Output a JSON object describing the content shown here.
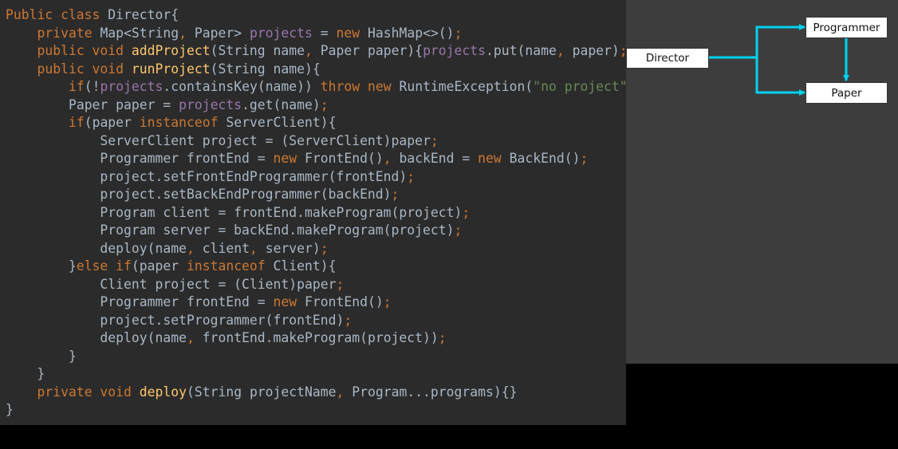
{
  "code": [
    [
      [
        "Public class ",
        "kw"
      ],
      [
        "Director{",
        ""
      ]
    ],
    [
      [
        "    ",
        ""
      ],
      [
        "private ",
        "kw"
      ],
      [
        "Map<String",
        ""
      ],
      [
        ", ",
        "kw"
      ],
      [
        "Paper> ",
        ""
      ],
      [
        "projects",
        "fld"
      ],
      [
        " = ",
        ""
      ],
      [
        "new ",
        "kw"
      ],
      [
        "HashMap<>()",
        ""
      ],
      [
        ";",
        "kw"
      ]
    ],
    [
      [
        "    ",
        ""
      ],
      [
        "public void ",
        "kw"
      ],
      [
        "addProject",
        "fn"
      ],
      [
        "(String name",
        ""
      ],
      [
        ", ",
        "kw"
      ],
      [
        "Paper paper){",
        ""
      ],
      [
        "projects",
        "fld"
      ],
      [
        ".put(name",
        ""
      ],
      [
        ", ",
        "kw"
      ],
      [
        "paper)",
        ""
      ],
      [
        ";",
        "kw"
      ],
      [
        "}",
        ""
      ]
    ],
    [
      [
        "    ",
        ""
      ],
      [
        "public void ",
        "kw"
      ],
      [
        "runProject",
        "fn"
      ],
      [
        "(String name){",
        ""
      ]
    ],
    [
      [
        "        ",
        ""
      ],
      [
        "if",
        "kw"
      ],
      [
        "(!",
        ""
      ],
      [
        "projects",
        "fld"
      ],
      [
        ".containsKey(name)) ",
        ""
      ],
      [
        "throw new ",
        "kw"
      ],
      [
        "RuntimeException(",
        ""
      ],
      [
        "\"no project\"",
        "str"
      ],
      [
        ")",
        ""
      ],
      [
        ";",
        "kw"
      ]
    ],
    [
      [
        "        ",
        ""
      ],
      [
        "Paper paper = ",
        ""
      ],
      [
        "projects",
        "fld"
      ],
      [
        ".get(name)",
        ""
      ],
      [
        ";",
        "kw"
      ]
    ],
    [
      [
        "        ",
        ""
      ],
      [
        "if",
        "kw"
      ],
      [
        "(paper ",
        ""
      ],
      [
        "instanceof ",
        "kw"
      ],
      [
        "ServerClient){",
        ""
      ]
    ],
    [
      [
        "            ",
        ""
      ],
      [
        "ServerClient project = (ServerClient)paper",
        ""
      ],
      [
        ";",
        "kw"
      ]
    ],
    [
      [
        "            ",
        ""
      ],
      [
        "Programmer frontEnd = ",
        ""
      ],
      [
        "new ",
        "kw"
      ],
      [
        "FrontEnd()",
        ""
      ],
      [
        ", ",
        "kw"
      ],
      [
        "backEnd = ",
        ""
      ],
      [
        "new ",
        "kw"
      ],
      [
        "BackEnd()",
        ""
      ],
      [
        ";",
        "kw"
      ]
    ],
    [
      [
        "            ",
        ""
      ],
      [
        "project.setFrontEndProgrammer(frontEnd)",
        ""
      ],
      [
        ";",
        "kw"
      ]
    ],
    [
      [
        "            ",
        ""
      ],
      [
        "project.setBackEndProgrammer(backEnd)",
        ""
      ],
      [
        ";",
        "kw"
      ]
    ],
    [
      [
        "            ",
        ""
      ],
      [
        "Program client = frontEnd.makeProgram(project)",
        ""
      ],
      [
        ";",
        "kw"
      ]
    ],
    [
      [
        "            ",
        ""
      ],
      [
        "Program server = backEnd.makeProgram(project)",
        ""
      ],
      [
        ";",
        "kw"
      ]
    ],
    [
      [
        "            ",
        ""
      ],
      [
        "deploy(name",
        ""
      ],
      [
        ", ",
        "kw"
      ],
      [
        "client",
        ""
      ],
      [
        ", ",
        "kw"
      ],
      [
        "server)",
        ""
      ],
      [
        ";",
        "kw"
      ]
    ],
    [
      [
        "        ",
        ""
      ],
      [
        "}",
        ""
      ],
      [
        "else if",
        "kw"
      ],
      [
        "(paper ",
        ""
      ],
      [
        "instanceof ",
        "kw"
      ],
      [
        "Client){",
        ""
      ]
    ],
    [
      [
        "            ",
        ""
      ],
      [
        "Client project = (Client)paper",
        ""
      ],
      [
        ";",
        "kw"
      ]
    ],
    [
      [
        "            ",
        ""
      ],
      [
        "Programmer frontEnd = ",
        ""
      ],
      [
        "new ",
        "kw"
      ],
      [
        "FrontEnd()",
        ""
      ],
      [
        ";",
        "kw"
      ]
    ],
    [
      [
        "            ",
        ""
      ],
      [
        "project.setProgrammer(frontEnd)",
        ""
      ],
      [
        ";",
        "kw"
      ]
    ],
    [
      [
        "            ",
        ""
      ],
      [
        "deploy(name",
        ""
      ],
      [
        ", ",
        "kw"
      ],
      [
        "frontEnd.makeProgram(project))",
        ""
      ],
      [
        ";",
        "kw"
      ]
    ],
    [
      [
        "        ",
        ""
      ],
      [
        "}",
        ""
      ]
    ],
    [
      [
        "    ",
        ""
      ],
      [
        "}",
        ""
      ]
    ],
    [
      [
        "    ",
        ""
      ],
      [
        "private void ",
        "kw"
      ],
      [
        "deploy",
        "fn"
      ],
      [
        "(String projectName",
        ""
      ],
      [
        ", ",
        "kw"
      ],
      [
        "Program...programs){}",
        ""
      ]
    ],
    [
      [
        "}",
        ""
      ]
    ]
  ],
  "diagram": {
    "nodes": {
      "director": "Director",
      "programmer": "Programmer",
      "paper": "Paper"
    },
    "edge_color": "#00d2f0"
  },
  "colors": {
    "code_bg": "#2b2b2b",
    "keyword": "#cc7832",
    "method": "#ffc66d",
    "field": "#9876aa",
    "string": "#6a8759",
    "plain": "#a9b7c6"
  }
}
